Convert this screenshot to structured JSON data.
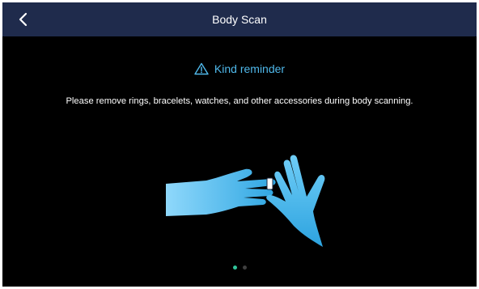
{
  "header": {
    "title": "Body Scan",
    "back_icon": "chevron-left-icon",
    "background": "#1f2b4c"
  },
  "reminder": {
    "icon": "warning-triangle-icon",
    "title": "Kind reminder",
    "color": "#4fb8ea"
  },
  "message": {
    "text": "Please remove rings, bracelets, watches, and other accessories during body scanning."
  },
  "illustration": {
    "icon": "hands-removing-ring-illustration",
    "color": "#4fc3f0"
  },
  "pagination": {
    "total": 2,
    "active_index": 0,
    "active_color": "#30c49a"
  }
}
